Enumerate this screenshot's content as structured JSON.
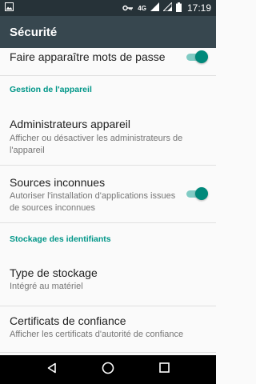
{
  "status_bar": {
    "network": "4G",
    "time": "17:19",
    "icons": [
      "image-icon",
      "key-icon",
      "signal-icon",
      "signal-4g-icon",
      "battery-icon"
    ]
  },
  "app_bar": {
    "title": "Sécurité"
  },
  "settings": {
    "show_passwords": {
      "title": "Faire apparaître mots de passe",
      "enabled": true
    },
    "device_admin_header": "Gestion de l'appareil",
    "device_admins": {
      "title": "Administrateurs appareil",
      "summary": "Afficher ou désactiver les administrateurs de l'appareil"
    },
    "unknown_sources": {
      "title": "Sources inconnues",
      "summary": "Autoriser l'installation d'applications issues de sources inconnues",
      "enabled": true
    },
    "credentials_header": "Stockage des identifiants",
    "storage_type": {
      "title": "Type de stockage",
      "summary": "Intégré au matériel"
    },
    "trusted_credentials": {
      "title": "Certificats de confiance",
      "summary": "Afficher les certificats d'autorité de confiance"
    }
  },
  "nav_bar": {
    "buttons": [
      "back-icon",
      "home-icon",
      "recents-icon"
    ]
  },
  "colors": {
    "accent": "#009688",
    "app_bar": "#37474f",
    "status_bar": "#263238"
  }
}
